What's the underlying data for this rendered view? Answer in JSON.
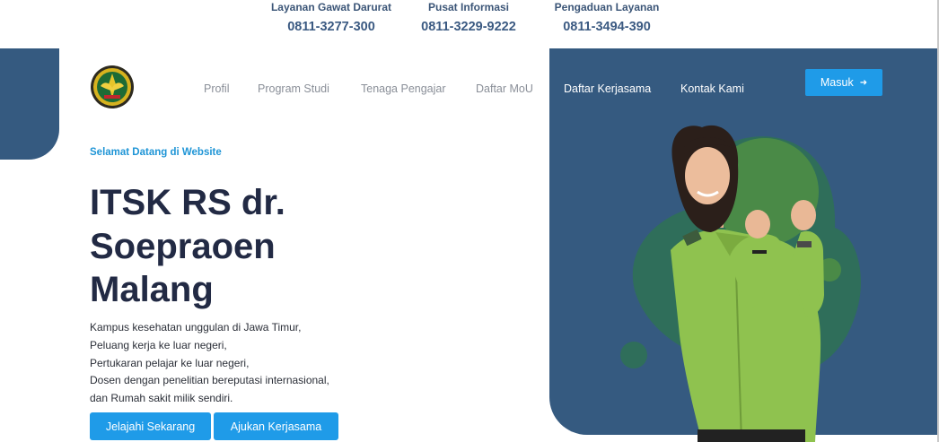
{
  "contacts": [
    {
      "label": "Layanan Gawat Darurat",
      "number": "0811-3277-300"
    },
    {
      "label": "Pusat Informasi",
      "number": "0811-3229-9222"
    },
    {
      "label": "Pengaduan Layanan",
      "number": "0811-3494-390"
    }
  ],
  "nav": {
    "items": [
      "Profil",
      "Program Studi",
      "Tenaga Pengajar",
      "Daftar MoU",
      "Daftar Kerjasama",
      "Kontak Kami"
    ],
    "login_label": "Masuk",
    "login_icon": "arrow-right-icon"
  },
  "hero": {
    "welcome": "Selamat Datang di Website",
    "title": "ITSK RS dr. Soepraoen Malang",
    "lines": [
      "Kampus kesehatan unggulan di Jawa Timur,",
      "Peluang kerja ke luar negeri,",
      "Pertukaran pelajar ke luar negeri,",
      "Dosen dengan penelitian bereputasi internasional,",
      "dan Rumah sakit milik sendiri."
    ],
    "cta_primary": "Jelajahi Sekarang",
    "cta_secondary": "Ajukan Kerjasama"
  },
  "colors": {
    "accent": "#1f9be8",
    "navy": "#355a80",
    "blob_green": "#2f6e5a",
    "uniform_green": "#8fc24f"
  }
}
